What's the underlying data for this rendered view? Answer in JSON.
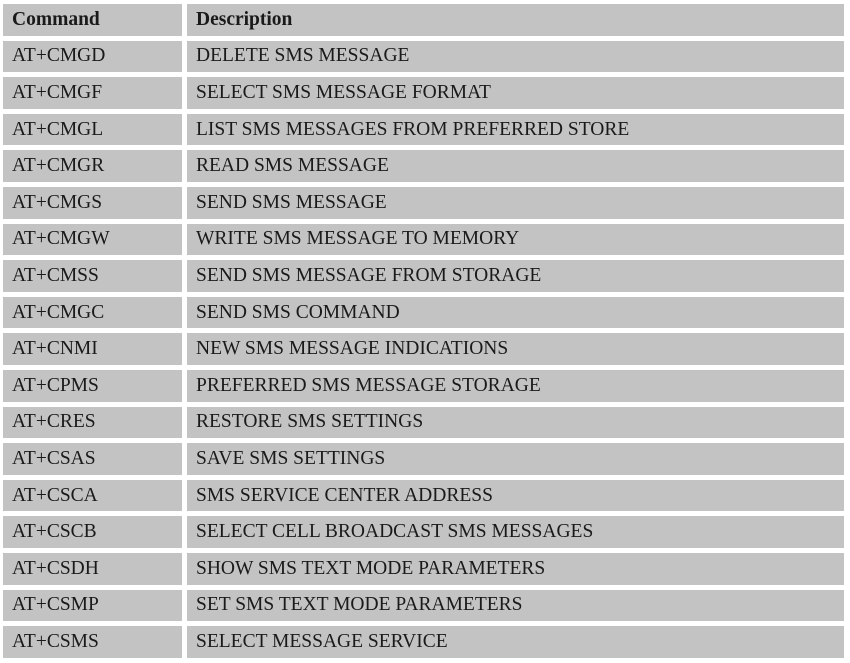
{
  "table": {
    "headers": [
      "Command",
      "Description"
    ],
    "rows": [
      [
        "AT+CMGD",
        "DELETE SMS MESSAGE"
      ],
      [
        "AT+CMGF",
        "SELECT SMS MESSAGE FORMAT"
      ],
      [
        "AT+CMGL",
        "LIST SMS MESSAGES FROM PREFERRED STORE"
      ],
      [
        "AT+CMGR",
        "READ SMS MESSAGE"
      ],
      [
        "AT+CMGS",
        "SEND SMS MESSAGE"
      ],
      [
        "AT+CMGW",
        "WRITE SMS MESSAGE TO MEMORY"
      ],
      [
        "AT+CMSS",
        "SEND SMS MESSAGE FROM STORAGE"
      ],
      [
        "AT+CMGC",
        "SEND SMS COMMAND"
      ],
      [
        "AT+CNMI",
        "NEW SMS MESSAGE INDICATIONS"
      ],
      [
        "AT+CPMS",
        "PREFERRED SMS MESSAGE STORAGE"
      ],
      [
        "AT+CRES",
        "RESTORE SMS SETTINGS"
      ],
      [
        "AT+CSAS",
        "SAVE SMS SETTINGS"
      ],
      [
        "AT+CSCA",
        "SMS SERVICE CENTER ADDRESS"
      ],
      [
        "AT+CSCB",
        "SELECT CELL BROADCAST SMS MESSAGES"
      ],
      [
        "AT+CSDH",
        "SHOW SMS TEXT MODE PARAMETERS"
      ],
      [
        "AT+CSMP",
        "SET SMS TEXT MODE PARAMETERS"
      ],
      [
        "AT+CSMS",
        "SELECT MESSAGE SERVICE"
      ]
    ]
  },
  "colors": {
    "cell_background": "#c3c3c3",
    "text": "#1a1a1a"
  }
}
